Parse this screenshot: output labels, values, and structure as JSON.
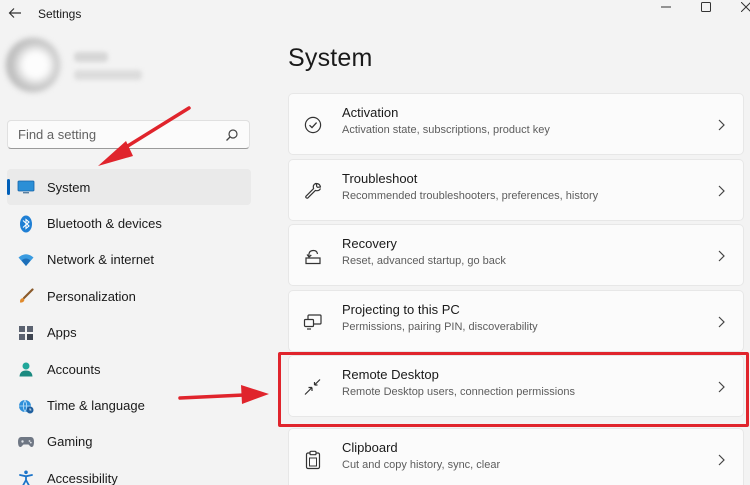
{
  "window": {
    "title": "Settings",
    "back_icon": "back-arrow-icon",
    "controls": [
      "minimize-icon",
      "maximize-icon",
      "close-icon"
    ]
  },
  "search": {
    "placeholder": "Find a setting",
    "icon": "search-icon"
  },
  "sidebar": {
    "items": [
      {
        "label": "System",
        "icon": "system-monitor-icon",
        "active": true
      },
      {
        "label": "Bluetooth & devices",
        "icon": "bluetooth-icon"
      },
      {
        "label": "Network & internet",
        "icon": "wifi-icon"
      },
      {
        "label": "Personalization",
        "icon": "paintbrush-icon"
      },
      {
        "label": "Apps",
        "icon": "apps-grid-icon"
      },
      {
        "label": "Accounts",
        "icon": "person-icon"
      },
      {
        "label": "Time & language",
        "icon": "globe-clock-icon"
      },
      {
        "label": "Gaming",
        "icon": "gamepad-icon"
      },
      {
        "label": "Accessibility",
        "icon": "accessibility-icon"
      }
    ]
  },
  "main": {
    "title": "System",
    "cards": [
      {
        "title": "Activation",
        "subtitle": "Activation state, subscriptions, product key",
        "icon": "check-circle-icon"
      },
      {
        "title": "Troubleshoot",
        "subtitle": "Recommended troubleshooters, preferences, history",
        "icon": "wrench-icon"
      },
      {
        "title": "Recovery",
        "subtitle": "Reset, advanced startup, go back",
        "icon": "recovery-icon"
      },
      {
        "title": "Projecting to this PC",
        "subtitle": "Permissions, pairing PIN, discoverability",
        "icon": "projector-icon"
      },
      {
        "title": "Remote Desktop",
        "subtitle": "Remote Desktop users, connection permissions",
        "icon": "remote-desktop-icon",
        "highlighted": true
      },
      {
        "title": "Clipboard",
        "subtitle": "Cut and copy history, sync, clear",
        "icon": "clipboard-icon"
      }
    ]
  },
  "colors": {
    "accent": "#005fb8",
    "annotation": "#e0242c",
    "background": "#f3f3f3",
    "card": "#fbfbfb"
  }
}
